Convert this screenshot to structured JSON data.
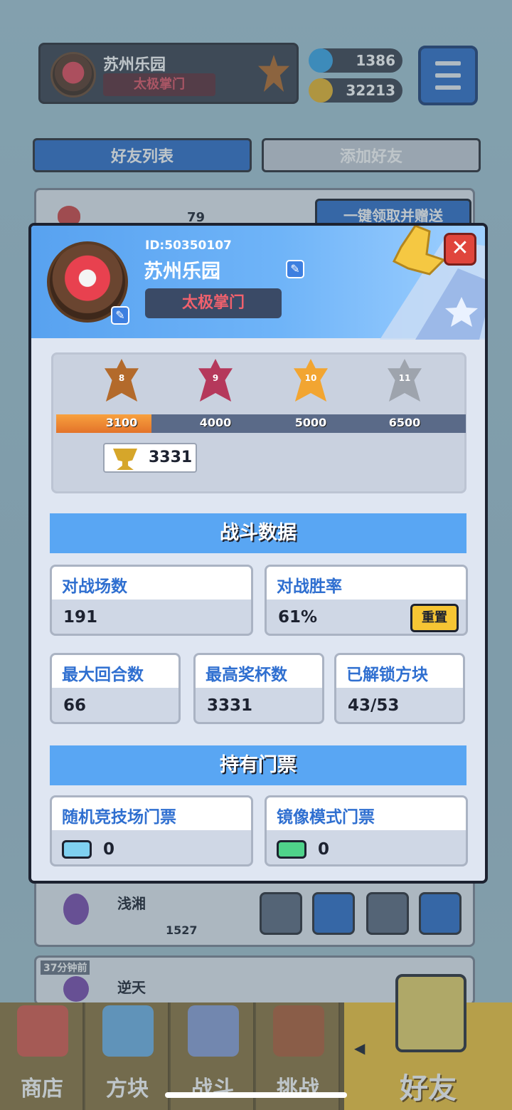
{
  "background": {
    "player_name": "苏州乐园",
    "player_title": "太极掌门",
    "gems": "1386",
    "coins": "32213",
    "tabs": [
      "好友列表",
      "添加好友"
    ],
    "top_row": {
      "hearts": "79",
      "claim_button": "一键领取并赠送"
    },
    "friends": [
      {
        "time": "",
        "name": "浅湘",
        "trophies": "1527"
      },
      {
        "time": "37分钟前",
        "name": "逆天",
        "trophies": ""
      }
    ]
  },
  "modal": {
    "id": "ID:50350107",
    "name": "苏州乐园",
    "title": "太极掌门",
    "close_symbol": "✕",
    "rank": {
      "badges": [
        {
          "level": "8",
          "threshold": "3100",
          "color": "#b36a2b"
        },
        {
          "level": "9",
          "threshold": "4000",
          "color": "#b5385b"
        },
        {
          "level": "10",
          "threshold": "5000",
          "color": "#f2a531"
        },
        {
          "level": "11",
          "threshold": "6500",
          "color": "#9ea4ad"
        }
      ],
      "progress_fraction": 0.232,
      "current_trophies": "3331"
    },
    "battle_section_title": "战斗数据",
    "stats": {
      "battles": {
        "label": "对战场数",
        "value": "191"
      },
      "win_rate": {
        "label": "对战胜率",
        "value": "61%",
        "reset_label": "重置"
      },
      "max_rounds": {
        "label": "最大回合数",
        "value": "66"
      },
      "max_trophies": {
        "label": "最高奖杯数",
        "value": "3331"
      },
      "unlocked_blocks": {
        "label": "已解锁方块",
        "value": "43/53"
      }
    },
    "tickets_section_title": "持有门票",
    "tickets": {
      "arena": {
        "label": "随机竞技场门票",
        "value": "0",
        "color": "#7fd0f0"
      },
      "mirror": {
        "label": "镜像模式门票",
        "value": "0",
        "color": "#4fd28a"
      }
    }
  },
  "nav": {
    "items": [
      "商店",
      "方块",
      "战斗",
      "挑战"
    ],
    "active": "好友",
    "arrow": "◀"
  }
}
